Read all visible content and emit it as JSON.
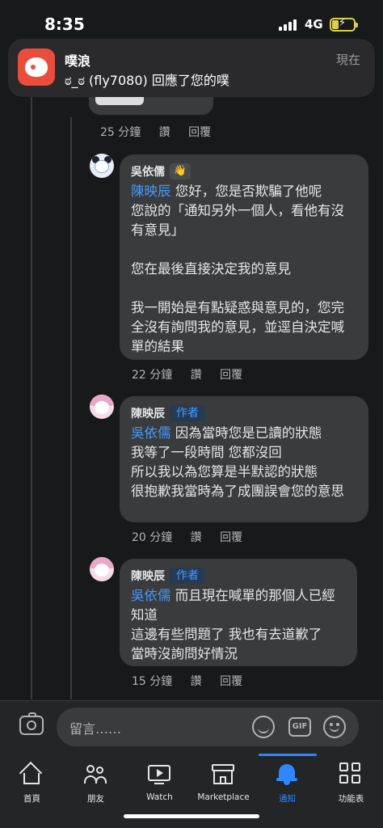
{
  "status_bar": {
    "time": "8:35",
    "network": "4G"
  },
  "notification": {
    "app_name": "噗浪",
    "time": "現在",
    "body": "ಠ_ಠ (fly7080) 回應了您的噗"
  },
  "comments": [
    {
      "time": "25 分鐘",
      "like": "讚",
      "reply": "回覆"
    },
    {
      "author": "吳依儒",
      "badge_icon": "wave-icon",
      "mention": "陳映辰",
      "text": " 您好，您是否欺騙了他呢\n您說的「通知另外一個人，看他有沒有意見」\n\n您在最後直接決定我的意見\n\n我一開始是有點疑惑與意見的，您完全沒有詢問我的意見，並逕自決定喊單的結果",
      "time": "22 分鐘",
      "like": "讚",
      "reply": "回覆"
    },
    {
      "author": "陳映辰",
      "badge": "作者",
      "mention": "吳依儒",
      "text": " 因為當時您是已讀的狀態\n我等了一段時間 您都沒回\n所以我以為您算是半默認的狀態\n很抱歉我當時為了成團誤會您的意思",
      "time": "20 分鐘",
      "like": "讚",
      "reply": "回覆"
    },
    {
      "author": "陳映辰",
      "badge": "作者",
      "mention": "吳依儒",
      "text": " 而且現在喊單的那個人已經知道\n這邊有些問題了 我也有去道歉了\n當時沒詢問好情況",
      "time": "15 分鐘",
      "like": "讚",
      "reply": "回覆"
    }
  ],
  "composer": {
    "placeholder": "留言……"
  },
  "tabs": [
    {
      "label": "首頁",
      "icon": "home-icon"
    },
    {
      "label": "朋友",
      "icon": "friends-icon"
    },
    {
      "label": "Watch",
      "icon": "watch-icon"
    },
    {
      "label": "Marketplace",
      "icon": "marketplace-icon"
    },
    {
      "label": "通知",
      "icon": "bell-icon",
      "active": true
    },
    {
      "label": "功能表",
      "icon": "menu-grid-icon"
    }
  ],
  "colors": {
    "accent": "#2d88ff",
    "mention": "#4599ff",
    "bubble": "#3a3b3c",
    "background": "#18191a"
  }
}
